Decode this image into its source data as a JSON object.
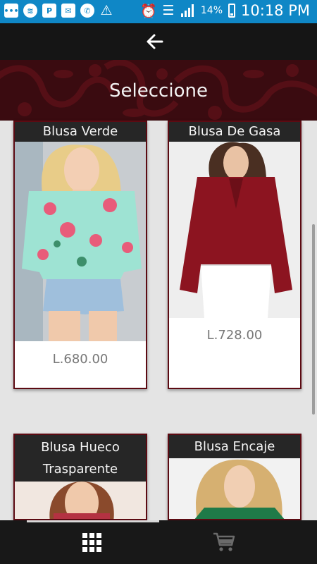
{
  "status_bar": {
    "battery": "14%",
    "time": "10:18 PM",
    "left_icons": [
      "message-icon",
      "spotify-icon",
      "p-icon",
      "chat-icon",
      "whatsapp-icon",
      "warning-icon"
    ],
    "right_icons": [
      "alarm-icon",
      "wifi-icon",
      "signal-icon",
      "battery-icon"
    ],
    "color": "#0f87c6"
  },
  "toolbar": {
    "back_icon": "arrow-left-icon"
  },
  "banner": {
    "title": "Seleccione",
    "color": "#3a0b10"
  },
  "products": [
    {
      "name": "Blusa Verde",
      "price": "L.680.00"
    },
    {
      "name": "Blusa De Gasa",
      "price": "L.728.00"
    },
    {
      "name": "Blusa Hueco Trasparente",
      "price": ""
    },
    {
      "name": "Blusa Encaje",
      "price": ""
    }
  ],
  "bottom_nav": {
    "items": [
      {
        "icon": "grid-icon",
        "active": true
      },
      {
        "icon": "cart-icon",
        "active": false
      }
    ]
  }
}
